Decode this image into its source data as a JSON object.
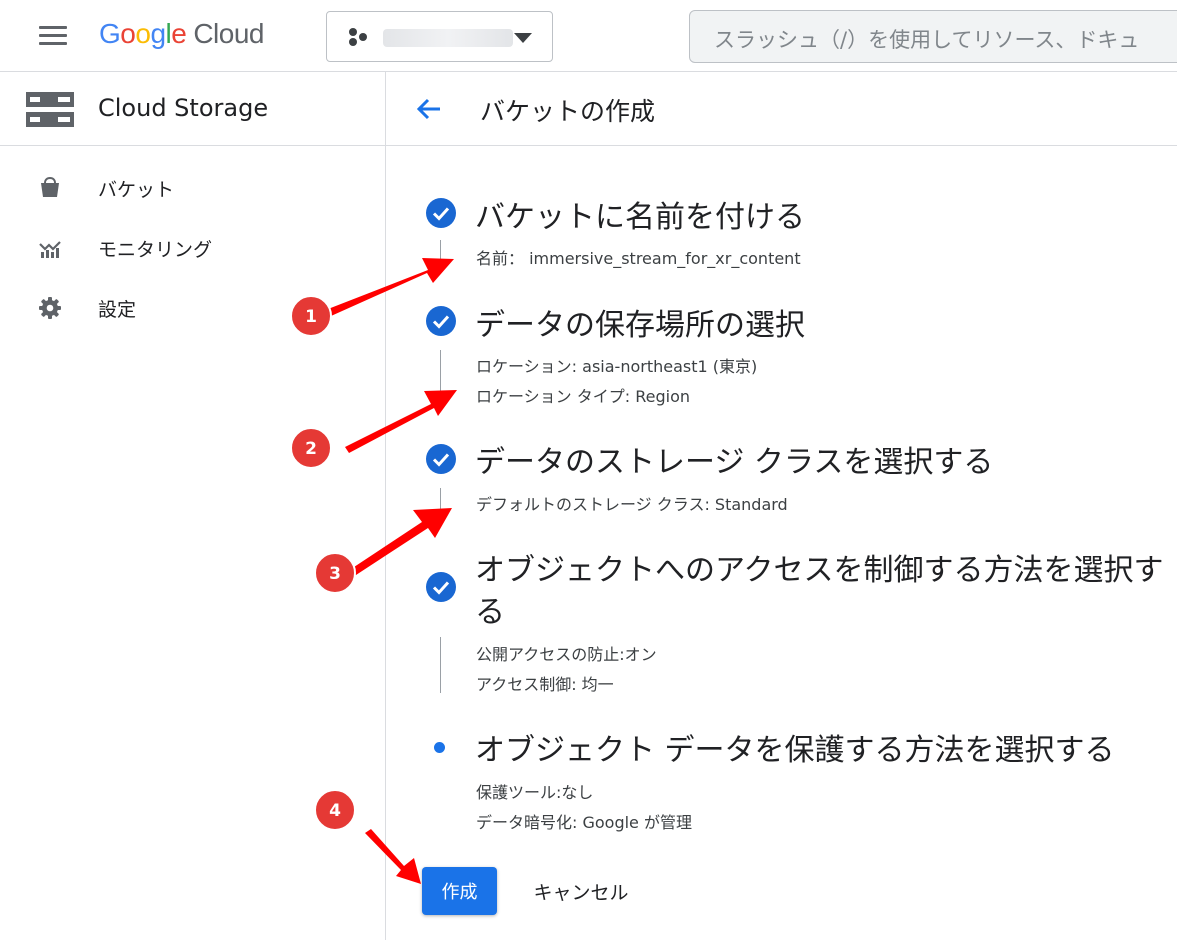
{
  "header": {
    "logo": {
      "letters": [
        "G",
        "o",
        "o",
        "g",
        "l",
        "e"
      ],
      "product": "Cloud"
    },
    "project_selector": {
      "name_redacted": true,
      "icon": "hexagon-cluster-icon"
    },
    "search": {
      "placeholder": "スラッシュ（/）を使用してリソース、ドキュ"
    }
  },
  "sidebar": {
    "title": "Cloud Storage",
    "items": [
      {
        "label": "バケット",
        "icon": "bucket-icon"
      },
      {
        "label": "モニタリング",
        "icon": "monitoring-chart-icon"
      },
      {
        "label": "設定",
        "icon": "gear-icon"
      }
    ]
  },
  "main": {
    "title": "バケットの作成",
    "steps": [
      {
        "title": "バケットに名前を付ける",
        "status": "complete",
        "details": [
          "名前： immersive_stream_for_xr_content"
        ]
      },
      {
        "title": "データの保存場所の選択",
        "status": "complete",
        "details": [
          "ロケーション: asia-northeast1 (東京)",
          "ロケーション タイプ: Region"
        ]
      },
      {
        "title": "データのストレージ クラスを選択する",
        "status": "complete",
        "details": [
          "デフォルトのストレージ クラス: Standard"
        ]
      },
      {
        "title_line1": "オブジェクトへのアクセスを制御する方法を選択す",
        "title_line2": "る",
        "status": "complete",
        "details": [
          "公開アクセスの防止:オン",
          "アクセス制御: 均一"
        ]
      },
      {
        "title": "オブジェクト データを保護する方法を選択する",
        "status": "current",
        "details": [
          "保護ツール:なし",
          "データ暗号化: Google が管理"
        ]
      }
    ],
    "create_label": "作成",
    "cancel_label": "キャンセル"
  },
  "annotations": {
    "badges": [
      "1",
      "2",
      "3",
      "4"
    ],
    "badge_color": "#e53935",
    "arrow_color": "#ff0000"
  },
  "colors": {
    "accent": "#1a73e8",
    "check": "#1967d2",
    "text": "#202124",
    "divider": "#dadce0"
  }
}
